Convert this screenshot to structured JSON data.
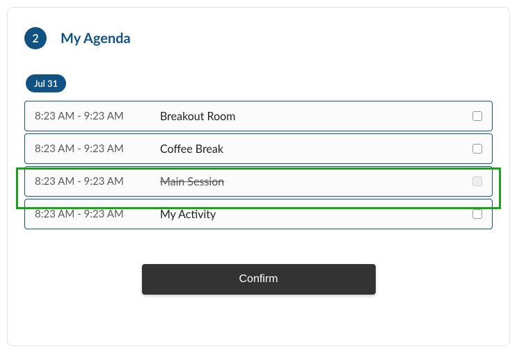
{
  "step_number": "2",
  "page_title": "My Agenda",
  "date_label": "Jul 31",
  "agenda": [
    {
      "time": "8:23 AM - 9:23 AM",
      "title": "Breakout Room",
      "strike": false,
      "check_disabled": false
    },
    {
      "time": "8:23 AM - 9:23 AM",
      "title": "Coffee Break",
      "strike": false,
      "check_disabled": false
    },
    {
      "time": "8:23 AM - 9:23 AM",
      "title": "Main Session",
      "strike": true,
      "check_disabled": true
    },
    {
      "time": "8:23 AM - 9:23 AM",
      "title": "My Activity",
      "strike": false,
      "check_disabled": false
    }
  ],
  "confirm_label": "Confirm",
  "highlighted_index": 2
}
